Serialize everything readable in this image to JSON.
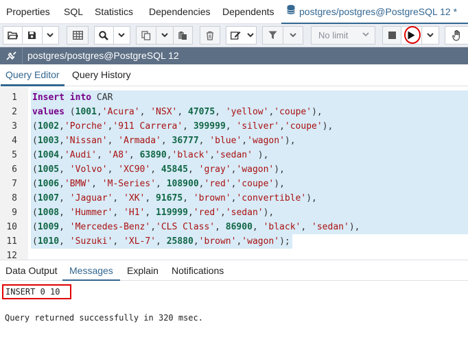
{
  "top_tabs": [
    {
      "label": "Properties"
    },
    {
      "label": "SQL"
    },
    {
      "label": "Statistics"
    },
    {
      "label": "Dependencies"
    },
    {
      "label": "Dependents"
    },
    {
      "label": "postgres/postgres@PostgreSQL 12 *",
      "icon": "database-icon",
      "active": true
    }
  ],
  "toolbar": {
    "limit_value": "No limit",
    "icons": [
      "open-file-icon",
      "save-icon",
      "grid-icon",
      "find-icon",
      "copy-icon",
      "paste-icon",
      "delete-icon",
      "edit-icon",
      "filter-icon",
      "stop-icon",
      "execute-icon",
      "hand-icon"
    ]
  },
  "connection": {
    "label": "postgres/postgres@PostgreSQL 12"
  },
  "editor_tabs": [
    {
      "label": "Query Editor",
      "active": true
    },
    {
      "label": "Query History"
    }
  ],
  "editor": {
    "lines": [
      {
        "n": "1",
        "text": "Insert into CAR"
      },
      {
        "n": "2",
        "text": "values (1001,'Acura', 'NSX', 47075, 'yellow','coupe'),"
      },
      {
        "n": "3",
        "text": "(1002,'Porche','911 Carrera', 399999, 'silver','coupe'),"
      },
      {
        "n": "4",
        "text": "(1003,'Nissan', 'Armada', 36777, 'blue','wagon'),"
      },
      {
        "n": "5",
        "text": "(1004,'Audi', 'A8', 63890,'black','sedan' ),"
      },
      {
        "n": "6",
        "text": "(1005, 'Volvo', 'XC90', 45845, 'gray','wagon'),"
      },
      {
        "n": "7",
        "text": "(1006,'BMW', 'M-Series', 108900,'red','coupe'),"
      },
      {
        "n": "8",
        "text": "(1007, 'Jaguar', 'XK', 91675, 'brown','convertible'),"
      },
      {
        "n": "9",
        "text": "(1008, 'Hummer', 'H1', 119999,'red','sedan'),"
      },
      {
        "n": "10",
        "text": "(1009, 'Mercedes-Benz','CLS Class', 86900, 'black', 'sedan'),"
      },
      {
        "n": "11",
        "text": "(1010, 'Suzuki', 'XL-7', 25880,'brown','wagon');"
      },
      {
        "n": "12",
        "text": ""
      }
    ]
  },
  "bottom_tabs": [
    {
      "label": "Data Output"
    },
    {
      "label": "Messages",
      "active": true
    },
    {
      "label": "Explain"
    },
    {
      "label": "Notifications"
    }
  ],
  "messages": {
    "insert_result": "INSERT 0 10",
    "success": "Query returned successfully in 320 msec."
  },
  "colors": {
    "accent": "#326690",
    "connection_bar": "#5d6f85",
    "highlight": "#e00000",
    "selection": "#d8ebf7",
    "keyword": "#770088",
    "string": "#aa1111",
    "number": "#116644"
  }
}
